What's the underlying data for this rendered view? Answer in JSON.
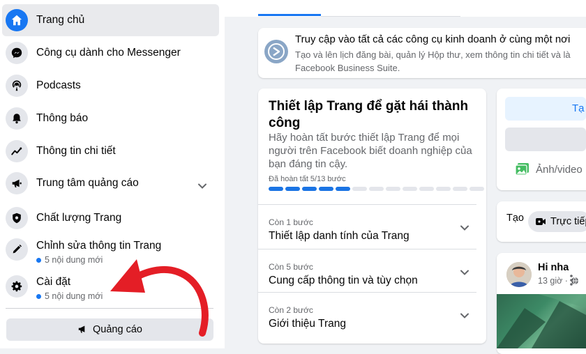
{
  "sidebar": {
    "items": [
      {
        "label": "Trang chủ",
        "icon": "home-icon"
      },
      {
        "label": "Công cụ dành cho Messenger",
        "icon": "messenger-icon"
      },
      {
        "label": "Podcasts",
        "icon": "podcast-icon"
      },
      {
        "label": "Thông báo",
        "icon": "bell-icon"
      },
      {
        "label": "Thông tin chi tiết",
        "icon": "insights-icon"
      },
      {
        "label": "Trung tâm quảng cáo",
        "icon": "megaphone-icon"
      },
      {
        "label": "Chất lượng Trang",
        "icon": "shield-icon"
      },
      {
        "label": "Chỉnh sửa thông tin Trang",
        "icon": "pencil-icon",
        "sub": "5 nội dung mới"
      },
      {
        "label": "Cài đặt",
        "icon": "gear-icon",
        "sub": "5 nội dung mới"
      }
    ],
    "ads_button": "Quảng cáo"
  },
  "business_suite": {
    "title": "Truy cập vào tất cả các công cụ kinh doanh ở cùng một nơi",
    "desc_line1": "Tạo và lên lịch đăng bài, quản lý Hộp thư, xem thông tin chi tiết và là",
    "desc_line2": "Facebook Business Suite."
  },
  "setup": {
    "title": "Thiết lập Trang để gặt hái thành công",
    "desc": "Hãy hoàn tất bước thiết lập Trang để mọi người trên Facebook biết doanh nghiệp của bạn đáng tin cậy.",
    "progress_label": "Đã hoàn tất 5/13 bước",
    "progress_done": 5,
    "progress_total": 13,
    "steps": [
      {
        "remaining": "Còn 1 bước",
        "title": "Thiết lập danh tính của Trang"
      },
      {
        "remaining": "Còn 5 bước",
        "title": "Cung cấp thông tin và tùy chọn"
      },
      {
        "remaining": "Còn 2 bước",
        "title": "Giới thiệu Trang"
      }
    ]
  },
  "composer": {
    "primary_label": "Tạ",
    "photo_label": "Ảnh/video"
  },
  "create": {
    "label": "Tạo",
    "live_label": "Trực tiếp"
  },
  "post": {
    "name": "Hi nha",
    "time": "13 giờ ·"
  },
  "colors": {
    "accent": "#1877f2",
    "arrow": "#e41e26"
  }
}
